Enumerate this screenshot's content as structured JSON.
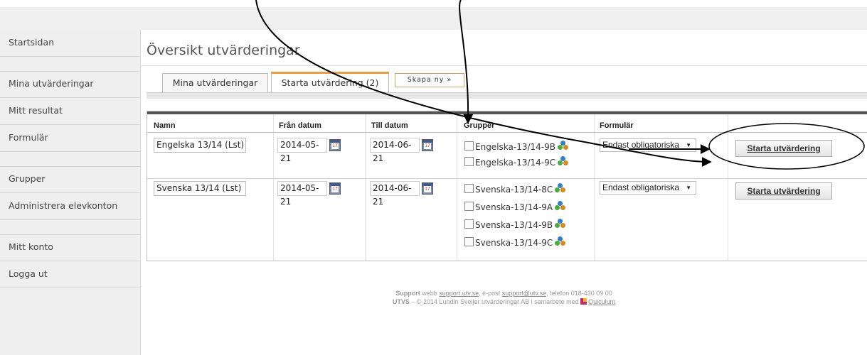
{
  "sidebar": {
    "items": [
      {
        "label": "Startsidan"
      },
      {
        "label": "Mina utvärderingar"
      },
      {
        "label": "Mitt resultat"
      },
      {
        "label": "Formulär"
      },
      {
        "label": "Grupper"
      },
      {
        "label": "Administrera elevkonton"
      },
      {
        "label": "Mitt konto"
      },
      {
        "label": "Logga ut"
      }
    ]
  },
  "main": {
    "title": "Översikt utvärderingar",
    "tabs": [
      {
        "label": "Mina utvärderingar"
      },
      {
        "label": "Starta utvärdering (2)",
        "active": true
      },
      {
        "label": "Skapa ny »"
      }
    ]
  },
  "table": {
    "headers": [
      "Namn",
      "Från datum",
      "Till datum",
      "Grupper",
      "Formulär"
    ],
    "rows": [
      {
        "name": "Engelska 13/14 (Lst)",
        "from": "2014-05-21",
        "to": "2014-06-21",
        "groups": [
          "Engelska-13/14-9B",
          "Engelska-13/14-9C"
        ],
        "form": "Endast obligatoriska",
        "button": "Starta utvärdering"
      },
      {
        "name": "Svenska 13/14 (Lst)",
        "from": "2014-05-21",
        "to": "2014-06-21",
        "groups": [
          "Svenska-13/14-8C",
          "Svenska-13/14-9A",
          "Svenska-13/14-9B",
          "Svenska-13/14-9C"
        ],
        "form": "Endast obligatoriska",
        "button": "Starta utvärdering"
      }
    ]
  },
  "footer": {
    "support_word": "Support",
    "web_prefix": "webb",
    "web_link": "support.utv.se",
    "mail_prefix": ", e-post",
    "mail_link": "support@utv.se",
    "phone": ", telefon 018-430 09 00",
    "company_bold": "UTVS",
    "company_text": "– © 2014 Lundin Sveijer utvärderingar AB i samarbete med",
    "partner": "Quiculum"
  },
  "icons": {
    "calendar": "calendar-icon",
    "group": "group-people-icon",
    "dropdown": "dropdown-arrow-icon"
  }
}
